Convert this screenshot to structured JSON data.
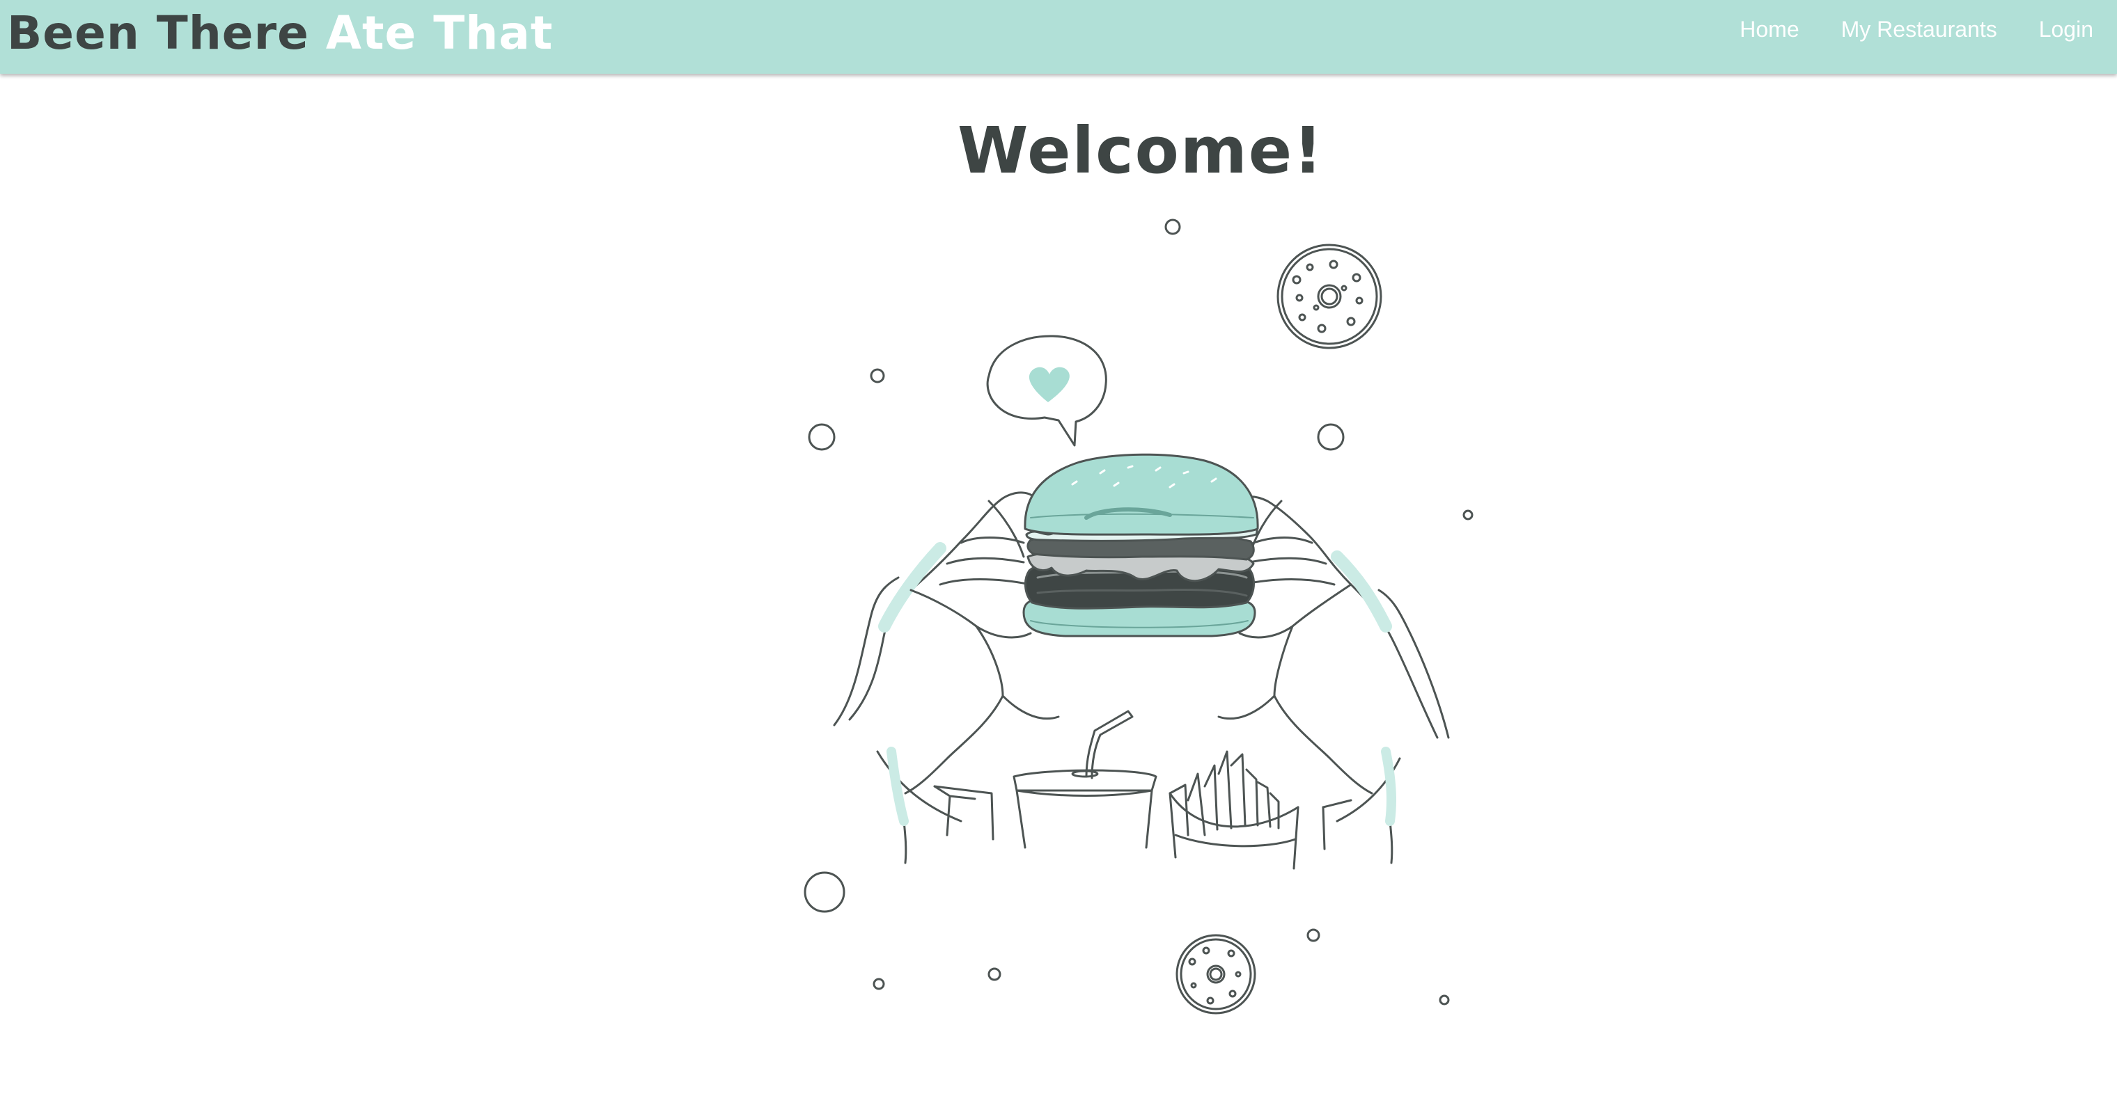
{
  "navbar": {
    "brand": {
      "part1": "Been There",
      "part2": "Ate That"
    },
    "links": [
      {
        "label": "Home"
      },
      {
        "label": "My Restaurants"
      },
      {
        "label": "Login"
      }
    ]
  },
  "main": {
    "title": "Welcome!",
    "illustration": {
      "icon": "burger-illustration"
    }
  },
  "colors": {
    "navbar_bg": "#b1e0d7",
    "accent": "#a8ddd3",
    "text_dark": "#3e4544",
    "nav_text": "#ffffff"
  }
}
